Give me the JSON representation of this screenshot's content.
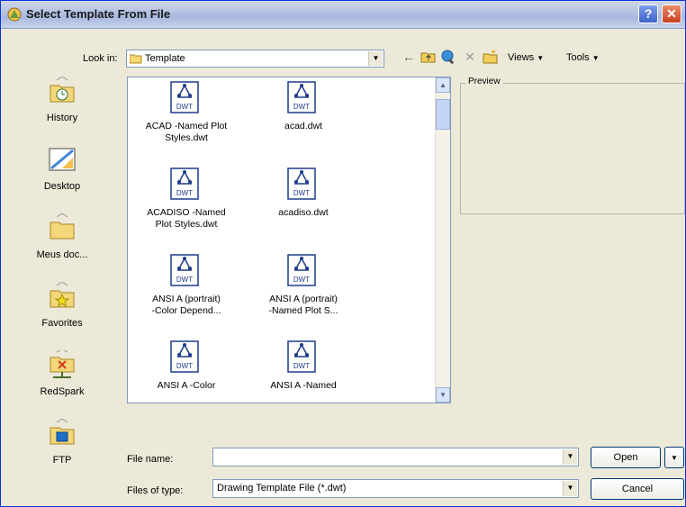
{
  "window": {
    "title": "Select Template From File"
  },
  "lookin": {
    "label": "Look in:",
    "value": "Template"
  },
  "toolbar": {
    "views": "Views",
    "tools": "Tools"
  },
  "places": [
    {
      "label": "History"
    },
    {
      "label": "Desktop"
    },
    {
      "label": "Meus doc..."
    },
    {
      "label": "Favorites"
    },
    {
      "label": "RedSpark"
    },
    {
      "label": "FTP"
    }
  ],
  "files": [
    {
      "line1": "ACAD -Named Plot",
      "line2": "Styles.dwt"
    },
    {
      "line1": "acad.dwt",
      "line2": ""
    },
    {
      "line1": "ACADISO -Named",
      "line2": "Plot Styles.dwt"
    },
    {
      "line1": "acadiso.dwt",
      "line2": ""
    },
    {
      "line1": "ANSI A (portrait)",
      "line2": "-Color Depend..."
    },
    {
      "line1": "ANSI A (portrait)",
      "line2": "-Named Plot S..."
    },
    {
      "line1": "ANSI A -Color",
      "line2": ""
    },
    {
      "line1": "ANSI A -Named",
      "line2": ""
    }
  ],
  "icon_text": "DWT",
  "preview": {
    "label": "Preview"
  },
  "filename": {
    "label": "File name:",
    "value": ""
  },
  "filetype": {
    "label": "Files of type:",
    "value": "Drawing Template File (*.dwt)"
  },
  "buttons": {
    "open": "Open",
    "cancel": "Cancel"
  }
}
